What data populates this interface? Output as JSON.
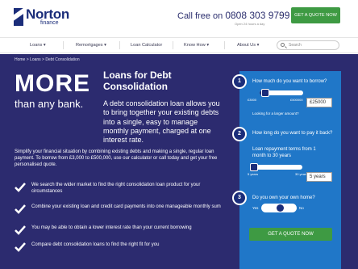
{
  "header": {
    "logo": {
      "name": "Norton",
      "sub": "finance"
    },
    "call_label": "Call free on",
    "phone": "0808 303 9799",
    "hours": "Open 24 hours a day",
    "or": "or",
    "quote_button": "GET A QUOTE NOW"
  },
  "nav": {
    "items": [
      {
        "label": "Loans",
        "chevron": "▾"
      },
      {
        "label": "Remortgages",
        "chevron": "▾"
      },
      {
        "label": "Loan Calculator",
        "chevron": ""
      },
      {
        "label": "Know How",
        "chevron": "▾"
      },
      {
        "label": "About Us",
        "chevron": "▾"
      }
    ],
    "search_placeholder": "Search"
  },
  "breadcrumb": "Home  >  Loans  >  Debt Consolidation",
  "hero": {
    "big": "MORE",
    "small": "than any bank.",
    "title": "Loans for Debt Consolidation",
    "desc": "A debt consolidation loan allows you to bring together your existing debts into a single, easy to manage monthly payment, charged at one interest rate.",
    "para": "Simplify your financial situation by combining existing debts and making a single, regular loan payment. To borrow from £3,000 to £500,000, use our calculator or call today and get your free personalised quote."
  },
  "features": [
    "We search the wider market to find the right consolidation loan product for your circumstances",
    "Combine your existing loan and credit card payments into one manageable monthly sum",
    "You may be able to obtain a lower interest rate than your current borrowing",
    "Compare debt consolidation loans to find the right fit for you"
  ],
  "calculator": {
    "steps": [
      {
        "num": "1",
        "question": "How much do you want to borrow?",
        "min": "£3000",
        "max": "£500000",
        "value": "£25000",
        "level": 0.05
      },
      {
        "num": "2",
        "question": "How long do you want to pay it back?",
        "min": "5 years",
        "max": "30 years",
        "value": "5 years",
        "level": 0.0
      },
      {
        "num": "3",
        "question": "Do you own your own home?",
        "yes": "Yes",
        "no": "No"
      }
    ],
    "term_hint": "Loan repayment terms from 1 month to 30 years",
    "larger_link": "Looking for a larger amount?",
    "quote_button": "GET A QUOTE NOW"
  }
}
